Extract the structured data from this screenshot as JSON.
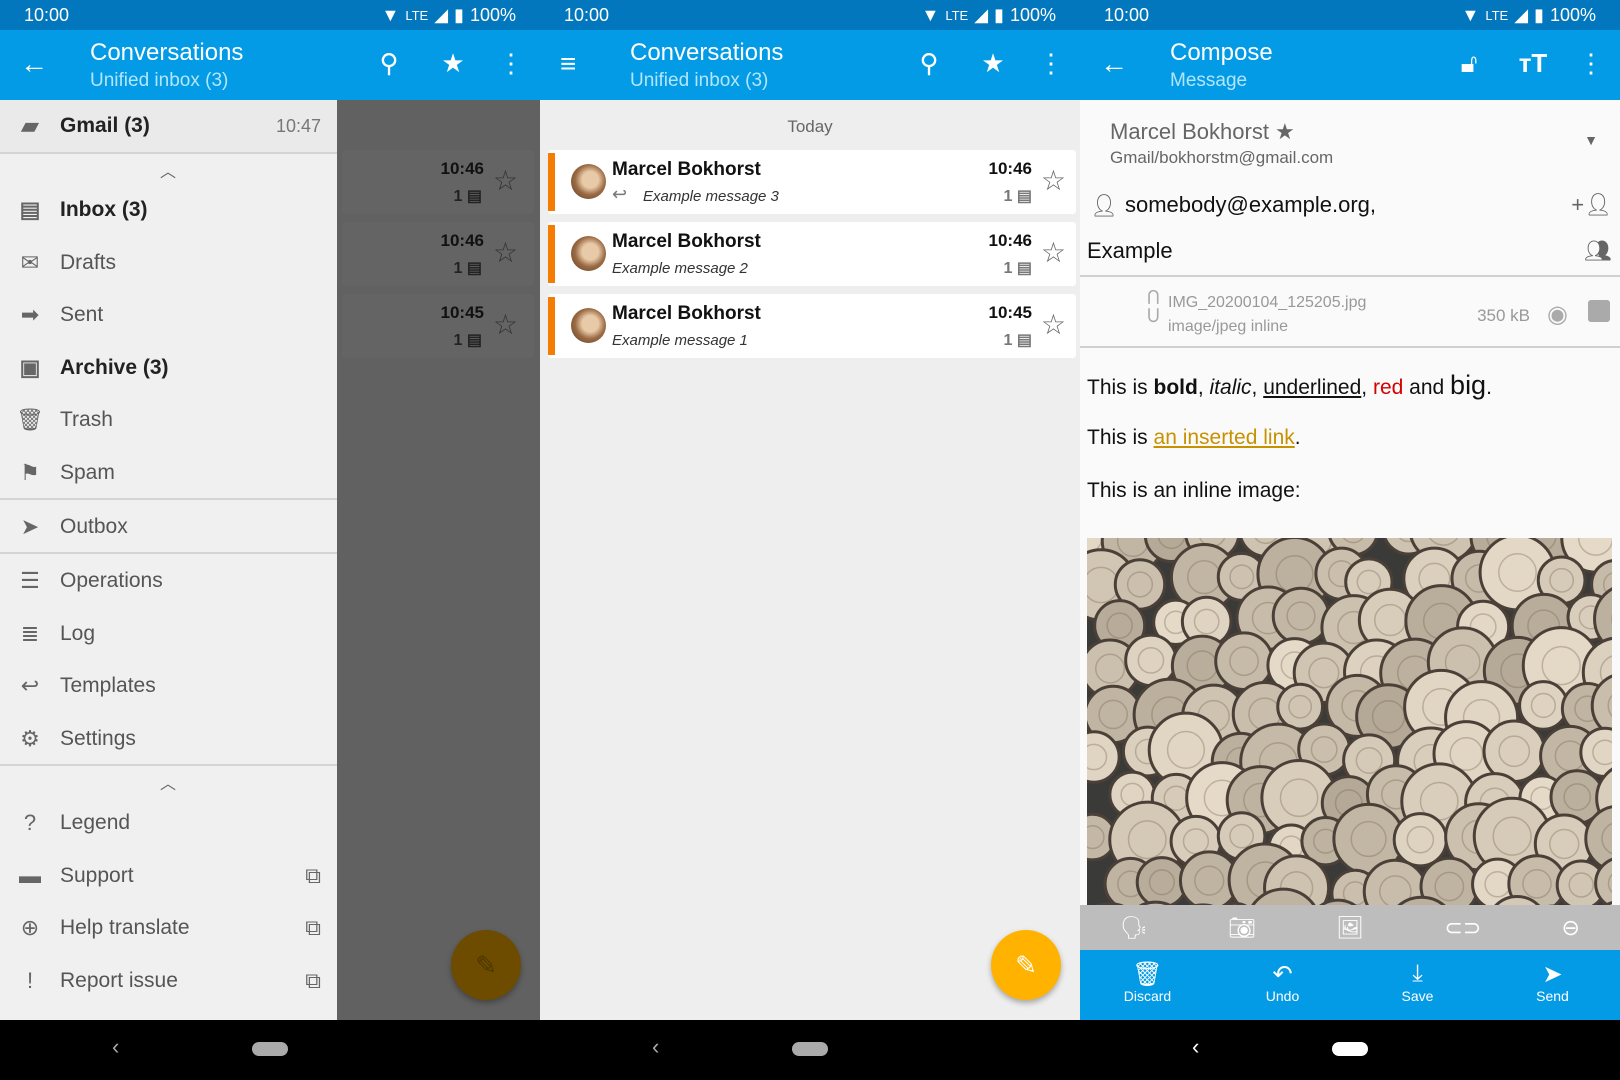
{
  "status": {
    "time": "10:00",
    "network": "LTE",
    "battery": "100%"
  },
  "colors": {
    "primary": "#039be5",
    "status_bar": "#0277bd",
    "accent": "#ffb300",
    "unread_bar": "#f57c00"
  },
  "panel1": {
    "title": "Conversations",
    "subtitle": "Unified inbox (3)",
    "drawer": {
      "account": {
        "label": "Gmail (3)",
        "time": "10:47",
        "icon": "folder-star-icon"
      },
      "folders": [
        {
          "label": "Inbox (3)",
          "icon": "inbox-icon",
          "bold": true
        },
        {
          "label": "Drafts",
          "icon": "drafts-icon"
        },
        {
          "label": "Sent",
          "icon": "sent-icon"
        },
        {
          "label": "Archive (3)",
          "icon": "archive-icon",
          "bold": true
        },
        {
          "label": "Trash",
          "icon": "trash-icon"
        },
        {
          "label": "Spam",
          "icon": "flag-icon"
        }
      ],
      "outbox": {
        "label": "Outbox",
        "icon": "send-icon"
      },
      "menu": [
        {
          "label": "Operations",
          "icon": "operations-icon"
        },
        {
          "label": "Log",
          "icon": "list-icon"
        },
        {
          "label": "Templates",
          "icon": "reply-icon"
        },
        {
          "label": "Settings",
          "icon": "settings-icon"
        }
      ],
      "extra": [
        {
          "label": "Legend",
          "icon": "help-icon"
        },
        {
          "label": "Support",
          "icon": "forum-icon",
          "external": true
        },
        {
          "label": "Help translate",
          "icon": "globe-icon",
          "external": true
        },
        {
          "label": "Report issue",
          "icon": "feedback-icon",
          "external": true
        }
      ]
    },
    "behind": [
      {
        "time": "10:46",
        "count": "1"
      },
      {
        "time": "10:46",
        "count": "1"
      },
      {
        "time": "10:45",
        "count": "1"
      }
    ]
  },
  "panel2": {
    "title": "Conversations",
    "subtitle": "Unified inbox (3)",
    "section": "Today",
    "messages": [
      {
        "from": "Marcel Bokhorst",
        "subject": "Example message 3",
        "time": "10:46",
        "count": "1",
        "replied": true
      },
      {
        "from": "Marcel Bokhorst",
        "subject": "Example message 2",
        "time": "10:46",
        "count": "1",
        "replied": false
      },
      {
        "from": "Marcel Bokhorst",
        "subject": "Example message 1",
        "time": "10:45",
        "count": "1",
        "replied": false
      }
    ]
  },
  "panel3": {
    "title": "Compose",
    "subtitle": "Message",
    "identity": {
      "name": "Marcel Bokhorst ★",
      "account": "Gmail/bokhorstm@gmail.com"
    },
    "to": "somebody@example.org,",
    "subject": "Example",
    "attachment": {
      "name": "IMG_20200104_125205.jpg",
      "type": "image/jpeg inline",
      "size": "350 kB"
    },
    "body": {
      "l1": {
        "a": "This is ",
        "bold": "bold",
        "b": ", ",
        "italic": "italic",
        "c": ", ",
        "underlined": "underlined",
        "d": ", ",
        "red": "red",
        "e": " and ",
        "big": "big",
        "f": "."
      },
      "l2": {
        "a": "This is ",
        "link": "an inserted link",
        "b": "."
      },
      "l3": "This is an inline image:"
    },
    "actions": [
      {
        "label": "Discard",
        "icon": "trash-icon"
      },
      {
        "label": "Undo",
        "icon": "undo-icon"
      },
      {
        "label": "Save",
        "icon": "download-icon"
      },
      {
        "label": "Send",
        "icon": "send-icon"
      }
    ]
  }
}
